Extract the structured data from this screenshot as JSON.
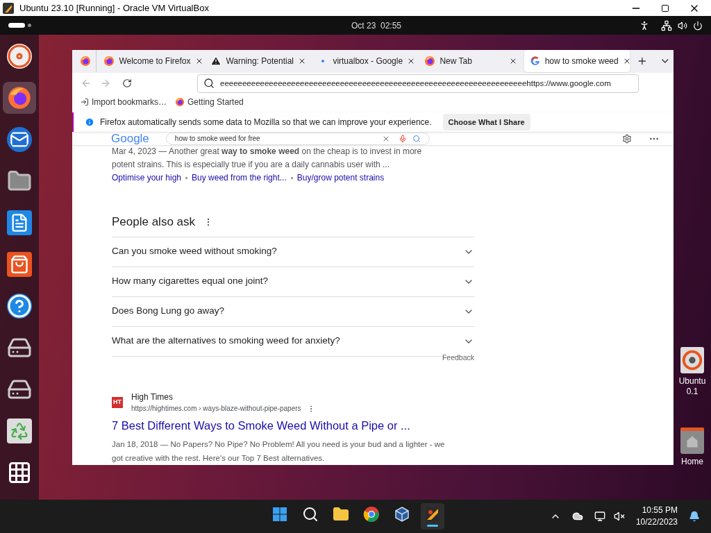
{
  "host_window": {
    "title": "Ubuntu 23.10 [Running] - Oracle VM VirtualBox"
  },
  "top_bar": {
    "clock": "Oct 23  02:55"
  },
  "dock": {
    "items": [
      {
        "selected": false
      },
      {
        "selected": true
      },
      {
        "selected": false
      },
      {
        "selected": false
      },
      {
        "selected": false
      },
      {
        "selected": false
      },
      {
        "selected": false
      },
      {
        "selected": false
      },
      {
        "selected": false
      },
      {
        "selected": false
      },
      {
        "selected": false
      }
    ]
  },
  "browser": {
    "tabs": [
      {
        "kind": "firefox",
        "title": "Welcome to Firefox",
        "selected": false
      },
      {
        "kind": "warning",
        "title": "Warning: Potential",
        "selected": false
      },
      {
        "kind": "loading",
        "title": "virtualbox - Google",
        "selected": false
      },
      {
        "kind": "firefox",
        "title": "New Tab",
        "selected": false
      },
      {
        "kind": "google",
        "title": "how to smoke weed",
        "selected": true
      }
    ],
    "url": "eeeeeeeeeeeeeeeeeeeeeeeeeeeeeeeeeeeeeeeeeeeeeeeeeeeeeeeeeeeeeeeeeeeeehttps://www.google.com",
    "bookmarks": [
      "Import bookmarks…",
      "Getting Started"
    ],
    "notification": {
      "text": "Firefox automatically sends some data to Mozilla so that we can improve your experience.",
      "button": "Choose What I Share"
    }
  },
  "google": {
    "logo": "Google",
    "query": "how to smoke weed for free",
    "snippet": "Mar 4, 2023 — Another great **way to smoke weed** on the cheap is to invest in more potent strains. This is especially true if you are a daily cannabis user with ...",
    "sitelinks": [
      "Optimise your high",
      "Buy weed from the right...",
      "Buy/grow potent strains"
    ],
    "people_also_ask": {
      "title": "People also ask",
      "questions": [
        {
          "text": "Can you smoke weed without smoking?",
          "expanded": false
        },
        {
          "text": "How many cigarettes equal one joint?",
          "expanded": false
        },
        {
          "text": "Does Bong Lung go away?",
          "expanded": false
        },
        {
          "text": "What are the alternatives to smoking weed for anxiety?",
          "expanded": false
        }
      ],
      "feedback": "Feedback"
    },
    "result": {
      "favicon": "HT",
      "site": "High Times",
      "url": "https://hightimes.com › ways-blaze-without-pipe-papers",
      "title": "7 Best Different Ways to Smoke Weed Without a Pipe or ...",
      "snippet": "Jan 18, 2018 — No Papers? No Pipe? No Problem! All you need is your bud and a lighter - we got creative with the rest. Here's our Top 7 Best alternatives."
    }
  },
  "desktop_icons": [
    {
      "lines": [
        "Ubuntu",
        "0.1"
      ]
    },
    {
      "lines": [
        "Home"
      ]
    }
  ],
  "taskbar": {
    "apps": [
      {
        "selected": false
      },
      {
        "selected": false
      },
      {
        "selected": false
      },
      {
        "selected": false
      },
      {
        "selected": false
      },
      {
        "selected": true
      }
    ],
    "time": "10:55 PM",
    "date": "10/22/2023"
  }
}
